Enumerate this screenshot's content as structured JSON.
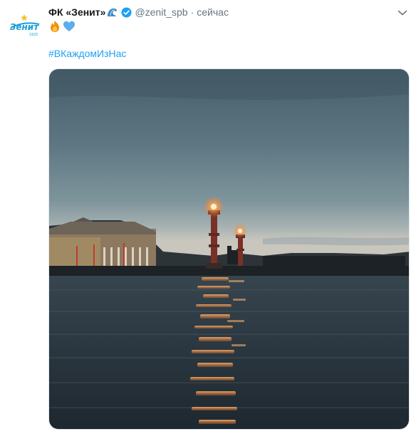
{
  "tweet": {
    "author_name": "ФК «Зенит»",
    "handle": "@zenit_spb",
    "separator": "·",
    "time": "сейчас",
    "hashtag": "#ВКаждомИзНас",
    "emojis": [
      "fire-emoji",
      "blue-heart-emoji"
    ],
    "name_emoji": "wave-emoji",
    "verified": true
  },
  "avatar": {
    "logo_text": "Зенит",
    "year": "1925"
  },
  "colors": {
    "link": "#1da1f2",
    "brand": "#1a9fd4",
    "muted": "#657786"
  }
}
